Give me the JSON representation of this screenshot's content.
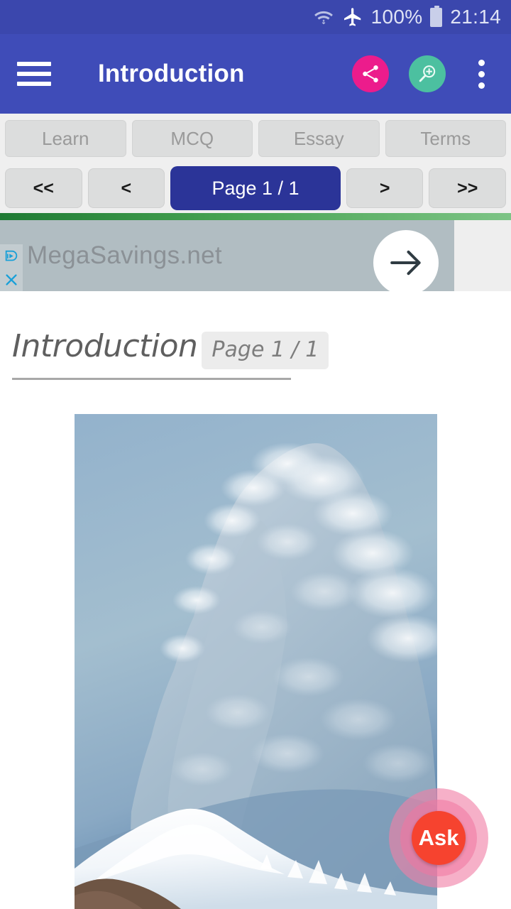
{
  "status_bar": {
    "wifi_icon": "wifi-icon",
    "airplane_icon": "airplane-mode-icon",
    "battery_percent": "100%",
    "battery_icon": "battery-full-icon",
    "time": "21:14"
  },
  "app_bar": {
    "menu_icon": "hamburger-menu-icon",
    "title": "Introduction",
    "share_icon": "share-icon",
    "zoom_icon": "zoom-in-icon",
    "overflow_icon": "overflow-menu-icon",
    "background_color": "#3f4cb8",
    "share_color": "#ec1c8c",
    "zoom_color": "#4cc0a0"
  },
  "tabs": [
    {
      "label": "Learn"
    },
    {
      "label": "MCQ"
    },
    {
      "label": "Essay"
    },
    {
      "label": "Terms"
    }
  ],
  "pagination": {
    "first_label": "<<",
    "prev_label": "<",
    "current_label": "Page 1 / 1",
    "next_label": ">",
    "last_label": ">>",
    "current_color": "#2b3498"
  },
  "ad": {
    "text": "MegaSavings.net",
    "adchoices_icon": "adchoices-icon",
    "close_icon": "close-icon",
    "cta_icon": "arrow-right-icon"
  },
  "article": {
    "title": "Introduction",
    "page_badge": "Page 1 / 1",
    "image_alt": "snow-covered-mountain-peak-photo"
  },
  "fab": {
    "label": "Ask",
    "color": "#f6432f"
  }
}
